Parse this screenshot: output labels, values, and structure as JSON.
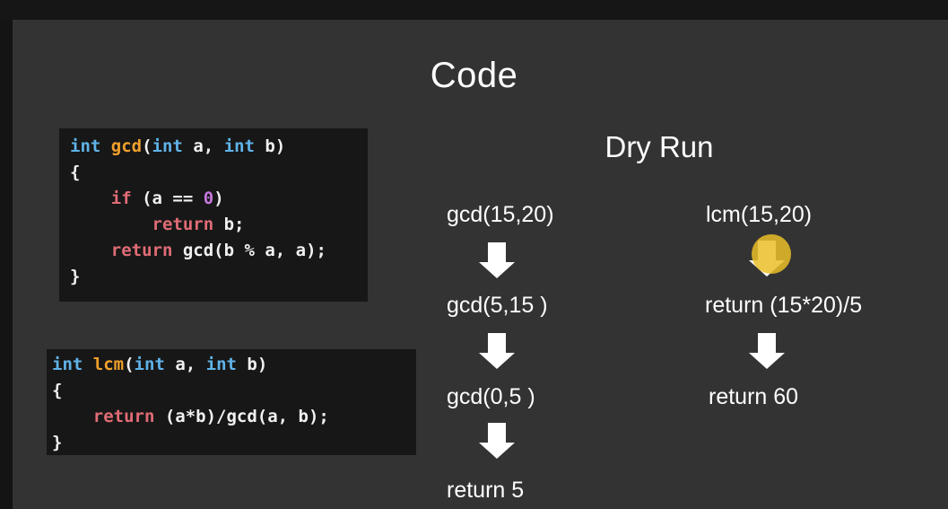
{
  "slide": {
    "title": "Code",
    "subtitle": "Dry Run"
  },
  "code": {
    "gcd": [
      [
        {
          "t": "int ",
          "c": "kw"
        },
        {
          "t": "gcd",
          "c": "fn"
        },
        {
          "t": "(",
          "c": "tx"
        },
        {
          "t": "int",
          "c": "kw"
        },
        {
          "t": " a, ",
          "c": "tx"
        },
        {
          "t": "int",
          "c": "kw"
        },
        {
          "t": " b)",
          "c": "tx"
        }
      ],
      [
        {
          "t": "{",
          "c": "tx"
        }
      ],
      [
        {
          "t": "    ",
          "c": "tx"
        },
        {
          "t": "if",
          "c": "ctl"
        },
        {
          "t": " (a == ",
          "c": "tx"
        },
        {
          "t": "0",
          "c": "num"
        },
        {
          "t": ")",
          "c": "tx"
        }
      ],
      [
        {
          "t": "        ",
          "c": "tx"
        },
        {
          "t": "return",
          "c": "ctl"
        },
        {
          "t": " b;",
          "c": "tx"
        }
      ],
      [
        {
          "t": "    ",
          "c": "tx"
        },
        {
          "t": "return",
          "c": "ctl"
        },
        {
          "t": " gcd(b % a, a);",
          "c": "tx"
        }
      ],
      [
        {
          "t": "}",
          "c": "tx"
        }
      ]
    ],
    "lcm": [
      [
        {
          "t": "int ",
          "c": "kw"
        },
        {
          "t": "lcm",
          "c": "fn"
        },
        {
          "t": "(",
          "c": "tx"
        },
        {
          "t": "int",
          "c": "kw"
        },
        {
          "t": " a, ",
          "c": "tx"
        },
        {
          "t": "int",
          "c": "kw"
        },
        {
          "t": " b)",
          "c": "tx"
        }
      ],
      [
        {
          "t": "{",
          "c": "tx"
        }
      ],
      [
        {
          "t": "    ",
          "c": "tx"
        },
        {
          "t": "return",
          "c": "ctl"
        },
        {
          "t": " (a*b)/gcd(a, b);",
          "c": "tx"
        }
      ],
      [
        {
          "t": "}",
          "c": "tx"
        }
      ]
    ]
  },
  "dry_run": {
    "gcd_steps": [
      "gcd(15,20)",
      "gcd(5,15 )",
      "gcd(0,5 )",
      "return 5"
    ],
    "lcm_steps": [
      "lcm(15,20)",
      "return (15*20)/5",
      "return 60"
    ]
  },
  "colors": {
    "keyword": "#5fb3e8",
    "function": "#f0a02c",
    "control": "#e06c75",
    "number": "#c678dd",
    "cursor_highlight": "#ebbe28"
  },
  "icons": {
    "flow_arrow": "down-arrow-icon",
    "pointer": "cursor-highlight-icon"
  }
}
